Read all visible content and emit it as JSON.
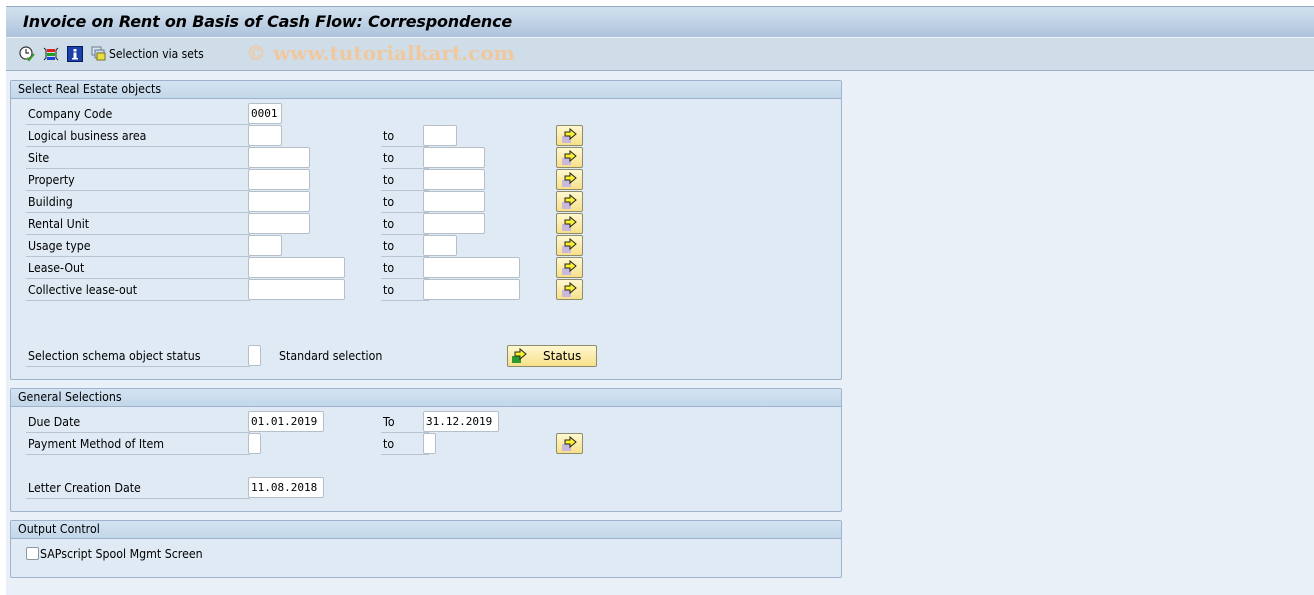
{
  "window": {
    "title": "Invoice on Rent on Basis of Cash Flow: Correspondence",
    "watermark": "© www.tutorialkart.com"
  },
  "toolbar": {
    "icons": [
      "execute-clock-icon",
      "selection-options-icon",
      "info-icon",
      "selection-sets-icon"
    ],
    "selection_via_sets_label": "Selection via sets"
  },
  "groups": {
    "real_estate": {
      "title": "Select Real Estate objects",
      "company_code": {
        "label": "Company Code",
        "value": "0001"
      },
      "ranges": [
        {
          "label": "Logical business area",
          "from": "",
          "to_label": "to",
          "to": ""
        },
        {
          "label": "Site",
          "from": "",
          "to_label": "to",
          "to": ""
        },
        {
          "label": "Property",
          "from": "",
          "to_label": "to",
          "to": ""
        },
        {
          "label": "Building",
          "from": "",
          "to_label": "to",
          "to": ""
        },
        {
          "label": "Rental Unit",
          "from": "",
          "to_label": "to",
          "to": ""
        },
        {
          "label": "Usage type",
          "from": "",
          "to_label": "to",
          "to": ""
        },
        {
          "label": "Lease-Out",
          "from": "",
          "to_label": "to",
          "to": ""
        },
        {
          "label": "Collective lease-out",
          "from": "",
          "to_label": "to",
          "to": ""
        }
      ],
      "status_schema": {
        "label": "Selection schema object status",
        "value": "",
        "description": "Standard selection",
        "button_label": "Status"
      }
    },
    "general": {
      "title": "General Selections",
      "due_date": {
        "label": "Due Date",
        "from": "01.01.2019",
        "to_label": "To",
        "to": "31.12.2019"
      },
      "payment_method": {
        "label": "Payment Method of Item",
        "from": "",
        "to_label": "to",
        "to": ""
      },
      "letter_creation_date": {
        "label": "Letter Creation Date",
        "value": "11.08.2018"
      }
    },
    "output": {
      "title": "Output Control",
      "sapscript_spool": {
        "label": "SAPscript Spool Mgmt Screen",
        "checked": false
      }
    }
  }
}
